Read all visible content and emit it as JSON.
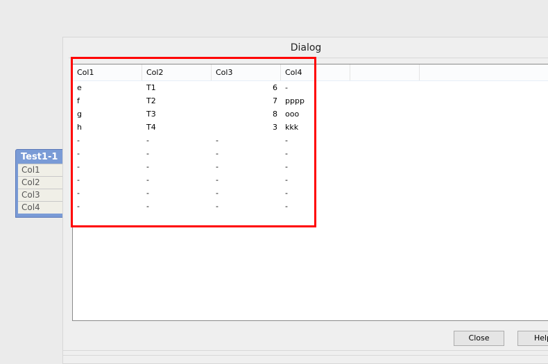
{
  "widget": {
    "title": "Test1-1",
    "fields": [
      "Col1",
      "Col2",
      "Col3",
      "Col4"
    ]
  },
  "dialog": {
    "title": "Dialog",
    "columns": [
      "Col1",
      "Col2",
      "Col3",
      "Col4"
    ],
    "rows": [
      [
        "e",
        "T1",
        "6",
        "-"
      ],
      [
        "f",
        "T2",
        "7",
        "pppp"
      ],
      [
        "g",
        "T3",
        "8",
        "ooo"
      ],
      [
        "h",
        "T4",
        "3",
        "kkk"
      ],
      [
        "-",
        "-",
        "-",
        "-"
      ],
      [
        "-",
        "-",
        "-",
        "-"
      ],
      [
        "-",
        "-",
        "-",
        "-"
      ],
      [
        "-",
        "-",
        "-",
        "-"
      ],
      [
        "-",
        "-",
        "-",
        "-"
      ],
      [
        "-",
        "-",
        "-",
        "-"
      ]
    ],
    "buttons": {
      "close": "Close",
      "help": "Help"
    }
  },
  "highlight_color": "#ff0000"
}
